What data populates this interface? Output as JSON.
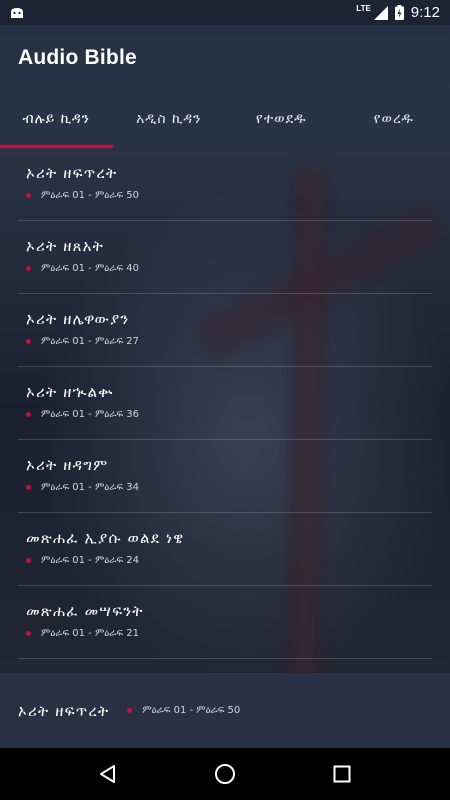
{
  "status_bar": {
    "time": "9:12",
    "network": "LTE"
  },
  "app": {
    "title": "Audio Bible"
  },
  "tabs": [
    {
      "label": "ብሉይ ኪዳን",
      "active": true
    },
    {
      "label": "አዲስ ኪዳን",
      "active": false
    },
    {
      "label": "የተወደዱ",
      "active": false
    },
    {
      "label": "የወረዱ",
      "active": false
    }
  ],
  "books": [
    {
      "title": "ኦሪት ዘፍጥረት",
      "range": "ምዕራፍ 01 - ምዕራፍ 50"
    },
    {
      "title": "ኦሪት ዘጸአት",
      "range": "ምዕራፍ 01 - ምዕራፍ 40"
    },
    {
      "title": "ኦሪት ዘሌዋውያን",
      "range": "ምዕራፍ 01 - ምዕራፍ 27"
    },
    {
      "title": "ኦሪት ዘኊልቍ",
      "range": "ምዕራፍ 01 - ምዕራፍ 36"
    },
    {
      "title": "ኦሪት ዘዳግም",
      "range": "ምዕራፍ 01 - ምዕራፍ 34"
    },
    {
      "title": "መጽሐፈ ኢያሱ ወልደ ነዌ",
      "range": "ምዕራፍ 01 - ምዕራፍ 24"
    },
    {
      "title": "መጽሐፈ መሣፍንት",
      "range": "ምዕራፍ 01 - ምዕራፍ 21"
    }
  ],
  "now_playing": {
    "title": "ኦሪት ዘፍጥረት",
    "range": "ምዕራፍ 01 - ምዕራፍ 50"
  },
  "colors": {
    "accent": "#c0123c",
    "app_bar": "#283346",
    "nav_bar": "#000000"
  },
  "icons": {
    "status_left": "android-icon",
    "signal": "signal-icon",
    "battery": "battery-charging-icon",
    "nav_back": "back-triangle-icon",
    "nav_home": "home-circle-icon",
    "nav_recents": "recents-square-icon"
  }
}
